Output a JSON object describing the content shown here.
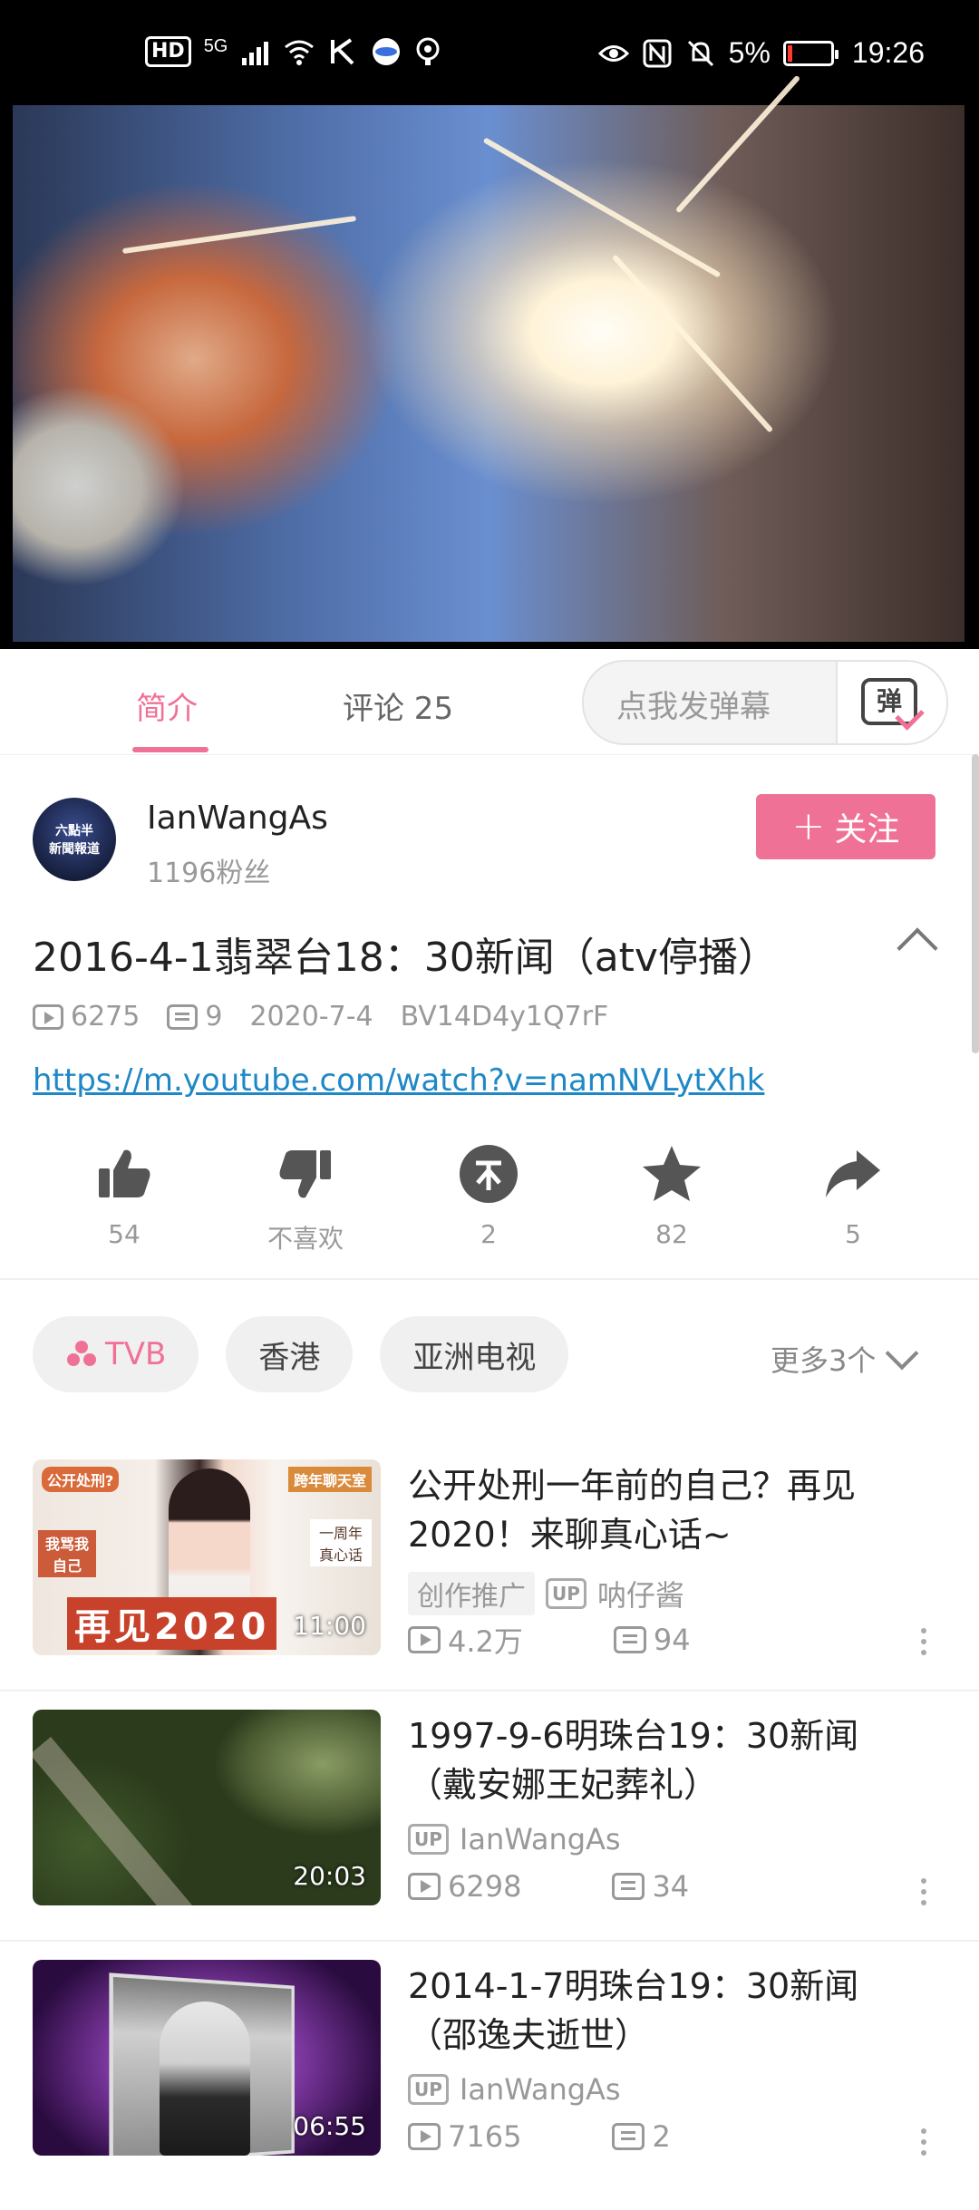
{
  "status_bar": {
    "hd": "HD",
    "net": "5G",
    "eye": "eye-icon",
    "nfc": "N",
    "battery_pct": "5%",
    "time": "19:26"
  },
  "tabs": {
    "intro": "简介",
    "comments": "评论 25",
    "danmaku_placeholder": "点我发弹幕",
    "danmaku_btn": "弹"
  },
  "uploader": {
    "avatar_text_1": "六點半",
    "avatar_text_2": "新聞報道",
    "name": "IanWangAs",
    "fans": "1196粉丝",
    "follow": "关注"
  },
  "video": {
    "title": "2016-4-1翡翠台18：30新闻（atv停播）",
    "views": "6275",
    "danmaku_count": "9",
    "date": "2020-7-4",
    "bvid": "BV14D4y1Q7rF",
    "link": "https://m.youtube.com/watch?v=namNVLytXhk"
  },
  "actions": [
    {
      "label": "54",
      "icon": "like-icon"
    },
    {
      "label": "不喜欢",
      "icon": "dislike-icon"
    },
    {
      "label": "2",
      "icon": "coin-icon"
    },
    {
      "label": "82",
      "icon": "star-icon"
    },
    {
      "label": "5",
      "icon": "share-icon"
    }
  ],
  "tags": {
    "items": [
      "TVB",
      "香港",
      "亚洲电视"
    ],
    "more": "更多3个"
  },
  "related": [
    {
      "title": "公开处刑一年前的自己？再见2020！来聊真心话~",
      "promo": "创作推广",
      "up_badge": "UP",
      "uploader": "呐仔酱",
      "views": "4.2万",
      "danmaku": "94",
      "duration": "11:00",
      "thumb_text_main": "再见2020",
      "thumb_text_1": "公开处刑?",
      "thumb_text_2": "跨年聊天室",
      "thumb_text_3": "一周年真心话",
      "thumb_text_4": "我骂我自己"
    },
    {
      "title": "1997-9-6明珠台19：30新闻（戴安娜王妃葬礼）",
      "up_badge": "UP",
      "uploader": "IanWangAs",
      "views": "6298",
      "danmaku": "34",
      "duration": "20:03"
    },
    {
      "title": "2014-1-7明珠台19：30新闻（邵逸夫逝世）",
      "up_badge": "UP",
      "uploader": "IanWangAs",
      "views": "7165",
      "danmaku": "2",
      "duration": "06:55"
    }
  ],
  "colors": {
    "accent": "#f07196",
    "link": "#1e88c7"
  }
}
